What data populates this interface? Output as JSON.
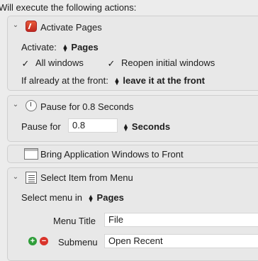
{
  "heading": "Will execute the following actions:",
  "actions": {
    "activate": {
      "title": "Activate Pages",
      "activate_label": "Activate:",
      "app": "Pages",
      "all_windows_label": "All windows",
      "reopen_label": "Reopen initial windows",
      "front_label": "If already at the front:",
      "front_value": "leave it at the front"
    },
    "pause": {
      "title": "Pause for 0.8 Seconds",
      "label": "Pause for",
      "value": "0.8",
      "unit": "Seconds"
    },
    "bring": {
      "title": "Bring Application Windows to Front"
    },
    "menu": {
      "title": "Select Item from Menu",
      "select_label": "Select menu in",
      "app": "Pages",
      "menu_title_label": "Menu Title",
      "menu_title_value": "File",
      "submenu_label": "Submenu",
      "submenu_value": "Open Recent"
    }
  },
  "glyphs": {
    "chevron": "⌄",
    "check": "✓",
    "up": "▲",
    "down": "▼",
    "plus": "+",
    "minus": "−"
  },
  "colors": {
    "add": "#2f9e3a",
    "remove": "#d9342b"
  }
}
